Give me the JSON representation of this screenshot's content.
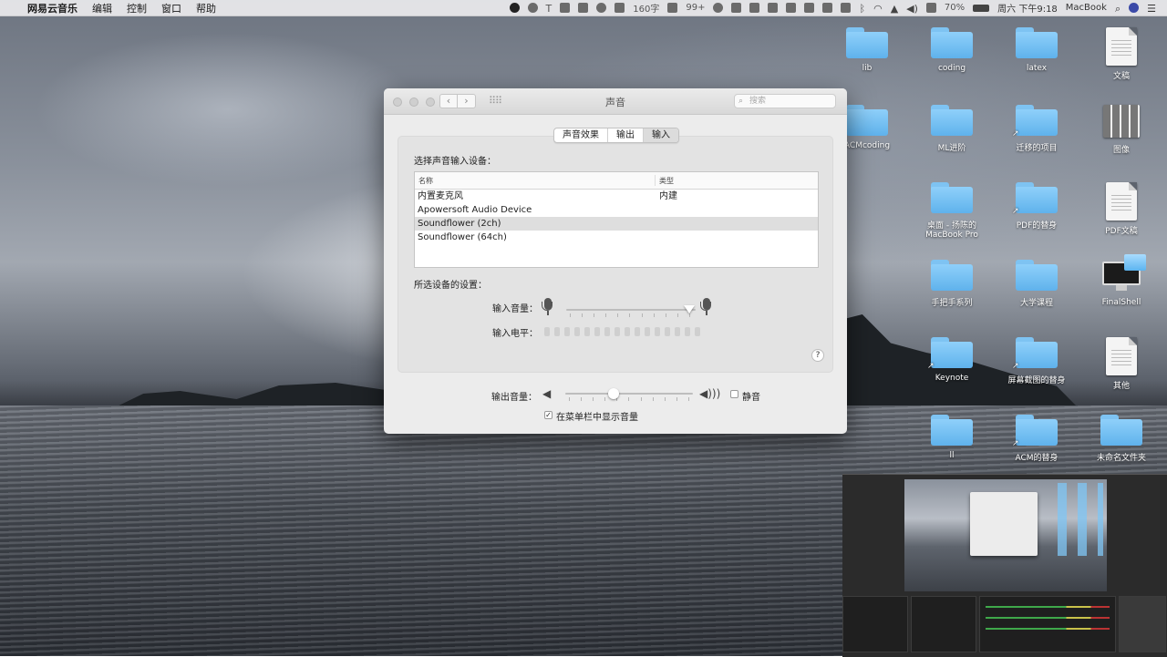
{
  "menubar": {
    "app_name": "网易云音乐",
    "menus": [
      "编辑",
      "控制",
      "窗口",
      "帮助"
    ],
    "status": {
      "word_count": "160字",
      "badge": "99+",
      "battery": "70%",
      "clock": "周六 下午9:18",
      "machine": "MacBook"
    }
  },
  "desktop_icons": [
    {
      "label": "lib",
      "type": "folder"
    },
    {
      "label": "coding",
      "type": "folder"
    },
    {
      "label": "latex",
      "type": "folder"
    },
    {
      "label": "文稿",
      "type": "document"
    },
    {
      "label": "ACMcoding",
      "type": "folder"
    },
    {
      "label": "ML进阶",
      "type": "folder"
    },
    {
      "label": "迁移的项目",
      "type": "folder-alias"
    },
    {
      "label": "图像",
      "type": "image-document"
    },
    {
      "label": "桌面 - 扬陈的 MacBook Pro",
      "type": "folder"
    },
    {
      "label": "PDF的替身",
      "type": "folder-alias"
    },
    {
      "label": "PDF文稿",
      "type": "document"
    },
    {
      "label": "手把手系列",
      "type": "folder"
    },
    {
      "label": "大学课程",
      "type": "folder"
    },
    {
      "label": "FinalShell",
      "type": "application"
    },
    {
      "label": "Keynote",
      "type": "folder-alias"
    },
    {
      "label": "屏幕截图的替身",
      "type": "folder-alias"
    },
    {
      "label": "其他",
      "type": "document"
    },
    {
      "label": "ll",
      "type": "folder"
    },
    {
      "label": "ACM的替身",
      "type": "folder-alias"
    },
    {
      "label": "未命名文件夹",
      "type": "folder"
    }
  ],
  "window": {
    "title": "声音",
    "search_placeholder": "搜索",
    "tabs": [
      {
        "label": "声音效果",
        "selected": false
      },
      {
        "label": "输出",
        "selected": false
      },
      {
        "label": "输入",
        "selected": true
      }
    ],
    "device_section_title": "选择声音输入设备：",
    "table": {
      "columns": [
        "名称",
        "类型"
      ],
      "rows": [
        {
          "name": "内置麦克风",
          "type": "内建",
          "selected": false
        },
        {
          "name": "Apowersoft Audio Device",
          "type": "",
          "selected": false
        },
        {
          "name": "Soundflower (2ch)",
          "type": "",
          "selected": true
        },
        {
          "name": "Soundflower (64ch)",
          "type": "",
          "selected": false
        }
      ]
    },
    "settings_title": "所选设备的设置：",
    "input_volume_label": "输入音量：",
    "input_volume_level": 0.95,
    "input_level_label": "输入电平：",
    "help_label": "?",
    "output_volume_label": "输出音量：",
    "output_volume_level": 0.38,
    "mute_label": "静音",
    "mute_checked": false,
    "show_in_menubar_label": "在菜单栏中显示音量",
    "show_in_menubar_checked": true,
    "checkmark": "✓"
  },
  "colors": {
    "folder_blue": "#6ab9ef",
    "window_bg": "#ececec",
    "selected_row": "#dedede"
  }
}
